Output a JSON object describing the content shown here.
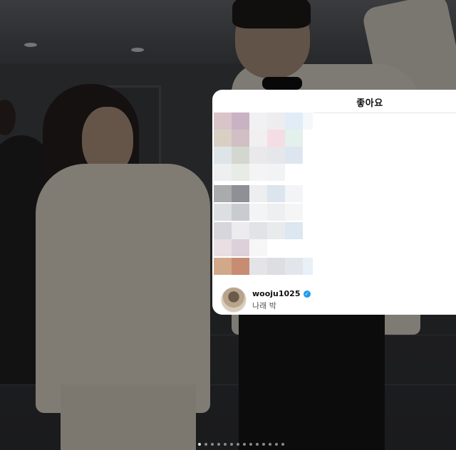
{
  "likes_panel": {
    "title": "좋아요",
    "user": {
      "username": "wooju1025",
      "verified": true,
      "display_name": "나래 박"
    }
  },
  "carousel": {
    "total_slides": 14,
    "active_index": 0
  },
  "colors": {
    "panel_bg": "#ffffff",
    "verified_blue": "#1d9bf0",
    "title_text": "#111111",
    "subtext": "#555555"
  }
}
